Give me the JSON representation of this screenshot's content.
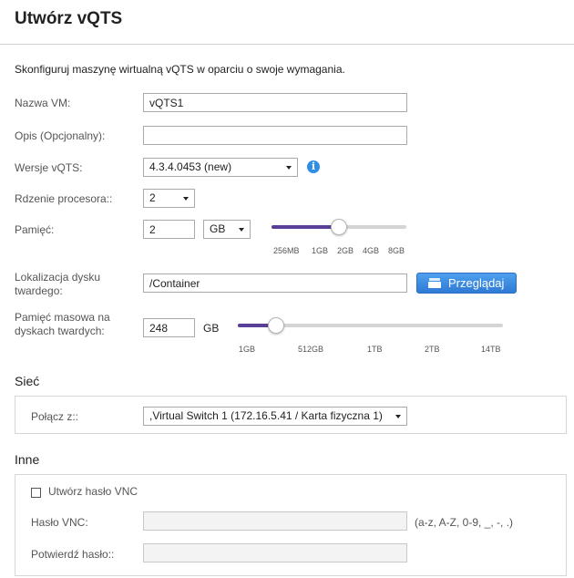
{
  "header": {
    "title": "Utwórz vQTS"
  },
  "intro": "Skonfiguruj maszynę wirtualną vQTS w oparciu o swoje wymagania.",
  "form": {
    "vm_name": {
      "label": "Nazwa VM:",
      "value": "vQTS1"
    },
    "description": {
      "label": "Opis (Opcjonalny):",
      "value": ""
    },
    "version": {
      "label": "Wersje vQTS:",
      "value": "4.3.4.0453 (new)"
    },
    "cpu_cores": {
      "label": "Rdzenie procesora::",
      "value": "2"
    },
    "memory": {
      "label": "Pamięć:",
      "value": "2",
      "unit": "GB",
      "slider": {
        "ticks": [
          "256MB",
          "1GB",
          "2GB",
          "4GB",
          "8GB"
        ],
        "current_tick_index": 2
      }
    },
    "disk_location": {
      "label_line1": "Lokalizacja dysku",
      "label_line2": "twardego:",
      "value": "/Container",
      "browse_label": "Przeglądaj"
    },
    "disk_size": {
      "label_line1": "Pamięć masowa na",
      "label_line2": "dyskach twardych:",
      "value": "248",
      "unit": "GB",
      "slider": {
        "ticks": [
          "1GB",
          "512GB",
          "1TB",
          "2TB",
          "14TB"
        ],
        "current_value_gb": 248
      }
    }
  },
  "network": {
    "section_title": "Sieć",
    "connect_label": "Połącz z::",
    "connect_value": ",Virtual Switch 1 (172.16.5.41 / Karta fizyczna 1)"
  },
  "other": {
    "section_title": "Inne",
    "vnc_checkbox_label": "Utwórz hasło VNC",
    "vnc_checked": false,
    "vnc_password_label": "Hasło VNC:",
    "vnc_password_hint": "(a-z, A-Z, 0-9, _, -, .)",
    "confirm_password_label": "Potwierdź hasło::"
  },
  "colors": {
    "slider_fill": "#5a3f96",
    "button_blue": "#2f7ad6",
    "info_blue": "#2f8ee5"
  }
}
